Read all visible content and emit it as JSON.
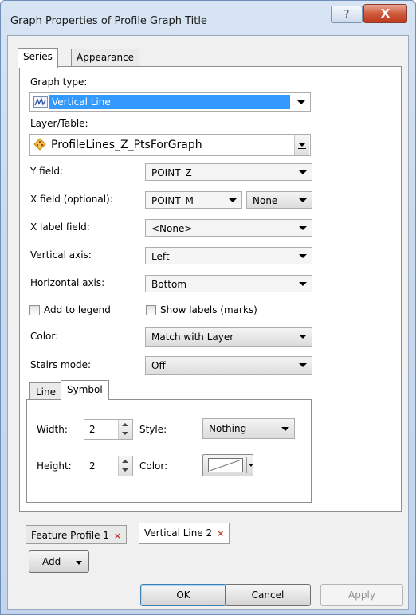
{
  "window": {
    "title": "Graph Properties of Profile Graph Title",
    "help_glyph": "?",
    "close_glyph": "X"
  },
  "main_tabs": [
    {
      "label": "Series",
      "active": true
    },
    {
      "label": "Appearance",
      "active": false
    }
  ],
  "graph_type": {
    "label": "Graph type:",
    "value": "Vertical Line",
    "highlight_color": "#3399ff"
  },
  "layer_table": {
    "label": "Layer/Table:",
    "value": "ProfileLines_Z_PtsForGraph"
  },
  "fields": {
    "y_field": {
      "label": "Y field:",
      "value": "POINT_Z"
    },
    "x_field": {
      "label": "X field (optional):",
      "value": "POINT_M",
      "sort_value": "None"
    },
    "x_label_field": {
      "label": "X label field:",
      "value": "<None>"
    },
    "vertical_axis": {
      "label": "Vertical axis:",
      "value": "Left"
    },
    "horizontal_axis": {
      "label": "Horizontal axis:",
      "value": "Bottom"
    }
  },
  "checkboxes": {
    "add_to_legend": {
      "label": "Add to legend",
      "checked": false
    },
    "show_labels": {
      "label": "Show labels (marks)",
      "checked": false
    }
  },
  "color": {
    "label": "Color:",
    "value": "Match with Layer"
  },
  "stairs_mode": {
    "label": "Stairs mode:",
    "value": "Off"
  },
  "inner_tabs": [
    {
      "label": "Line",
      "active": false
    },
    {
      "label": "Symbol",
      "active": true
    }
  ],
  "symbol": {
    "width_label": "Width:",
    "width_value": "2",
    "height_label": "Height:",
    "height_value": "2",
    "style_label": "Style:",
    "style_value": "Nothing",
    "color_label": "Color:"
  },
  "series_tabs": [
    {
      "label": "Feature Profile 1",
      "active": false,
      "close_glyph": "×"
    },
    {
      "label": "Vertical Line 2",
      "active": true,
      "close_glyph": "×"
    }
  ],
  "buttons": {
    "add": "Add",
    "ok": "OK",
    "cancel": "Cancel",
    "apply": "Apply"
  }
}
